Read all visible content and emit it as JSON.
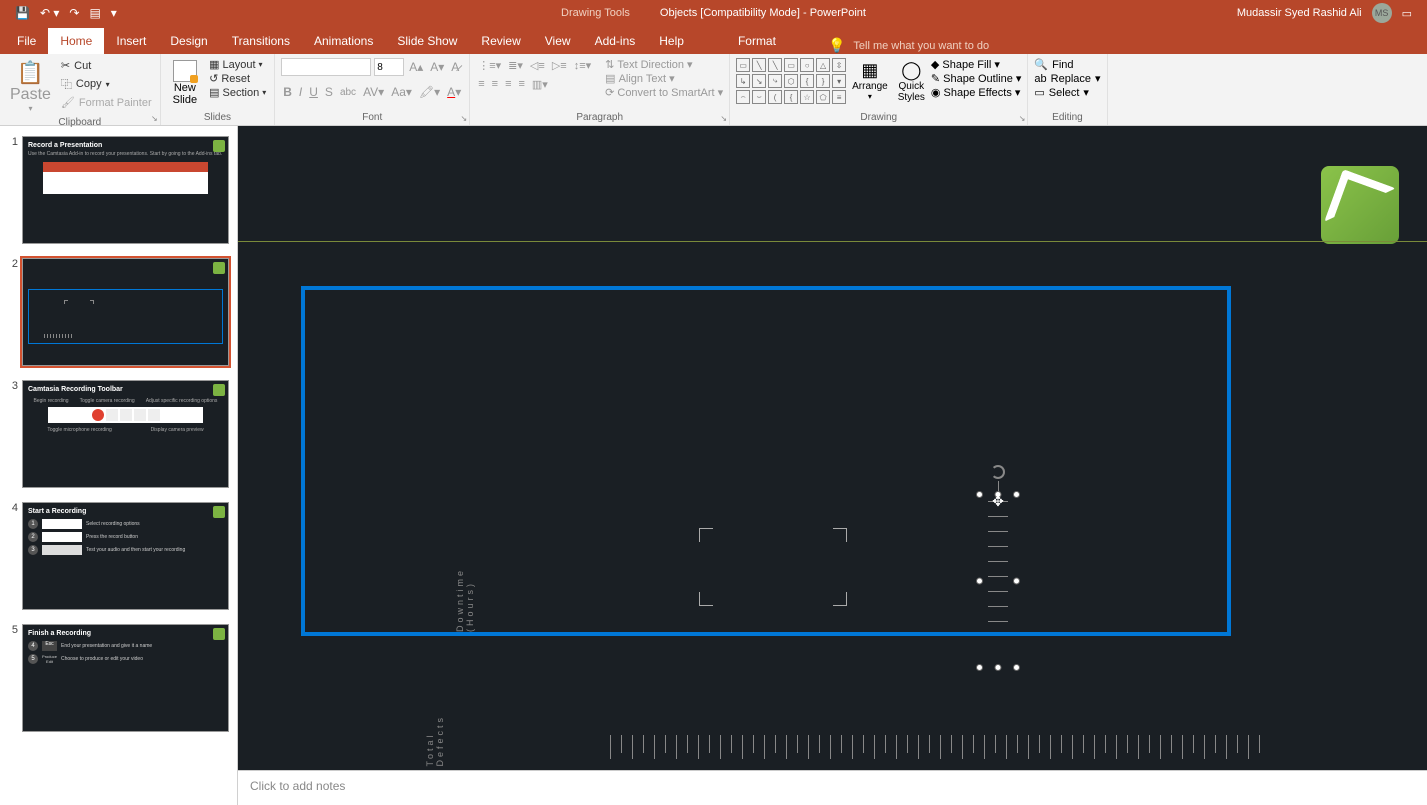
{
  "titlebar": {
    "drawing_tools": "Drawing Tools",
    "doc_title": "Objects [Compatibility Mode]  -  PowerPoint",
    "user_name": "Mudassir Syed Rashid Ali",
    "user_initials": "MS"
  },
  "menu": {
    "tabs": [
      "File",
      "Home",
      "Insert",
      "Design",
      "Transitions",
      "Animations",
      "Slide Show",
      "Review",
      "View",
      "Add-ins",
      "Help",
      "Format"
    ],
    "active_tab": "Home",
    "tell_me": "Tell me what you want to do"
  },
  "ribbon": {
    "clipboard": {
      "label": "Clipboard",
      "paste": "Paste",
      "cut": "Cut",
      "copy": "Copy",
      "format_painter": "Format Painter"
    },
    "slides": {
      "label": "Slides",
      "new_slide": "New\nSlide",
      "layout": "Layout",
      "reset": "Reset",
      "section": "Section"
    },
    "font": {
      "label": "Font",
      "font_name": "",
      "font_size": "8"
    },
    "paragraph": {
      "label": "Paragraph",
      "text_direction": "Text Direction",
      "align_text": "Align Text",
      "convert_smartart": "Convert to SmartArt"
    },
    "drawing": {
      "label": "Drawing",
      "arrange": "Arrange",
      "quick_styles": "Quick\nStyles",
      "shape_fill": "Shape Fill",
      "shape_outline": "Shape Outline",
      "shape_effects": "Shape Effects"
    },
    "editing": {
      "label": "Editing",
      "find": "Find",
      "replace": "Replace",
      "select": "Select"
    }
  },
  "slides_panel": {
    "thumbs": [
      {
        "num": "1",
        "title": "Record a Presentation",
        "text": "Use the Camtasia Add-in to record your presentations. Start by going to the Add-ins tab."
      },
      {
        "num": "2",
        "title": ""
      },
      {
        "num": "3",
        "title": "Camtasia Recording Toolbar",
        "cols": [
          "Begin recording",
          "Toggle camera recording",
          "Adjust specific recording options"
        ],
        "below": [
          "Toggle microphone recording",
          "Display camera preview"
        ]
      },
      {
        "num": "4",
        "title": "Start a Recording",
        "steps": [
          {
            "n": "1",
            "t": "Select recording options"
          },
          {
            "n": "2",
            "t": "Press the record button"
          },
          {
            "n": "3",
            "t": "Test your audio and then start your recording"
          }
        ]
      },
      {
        "num": "5",
        "title": "Finish a Recording",
        "steps": [
          {
            "n": "4",
            "t": "End your presentation and give it a name"
          },
          {
            "n": "5",
            "t": "Choose to produce or edit your video"
          }
        ],
        "labels": [
          "Esc",
          "Produce",
          "Edit"
        ]
      }
    ],
    "selected": 2
  },
  "slide_content": {
    "y_label_1": "Downtime (Hours)",
    "y_label_2": "Total Defects"
  },
  "notes": {
    "placeholder": "Click to add notes"
  }
}
